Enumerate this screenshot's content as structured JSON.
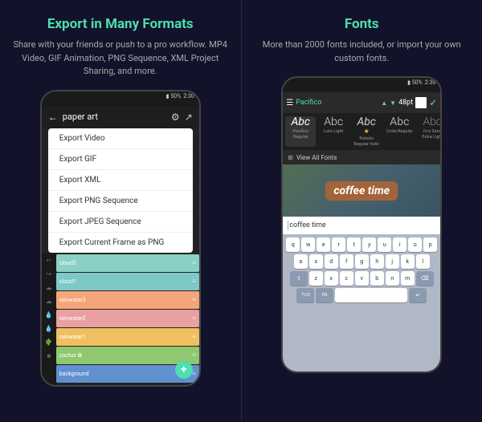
{
  "left": {
    "title": "Export in Many Formats",
    "description": "Share with your friends or push to a pro workflow. MP4 Video, GIF Animation, PNG Sequence, XML Project Sharing, and more.",
    "phone": {
      "status": "50%",
      "time": "2:30",
      "header_title": "paper art",
      "export_items": [
        "Export Video",
        "Export GIF",
        "Export XML",
        "Export PNG Sequence",
        "Export JPEG Sequence",
        "Export Current Frame as PNG"
      ],
      "layers": [
        {
          "name": "cloud2",
          "color": "#89d0c5"
        },
        {
          "name": "cloud1",
          "color": "#7ec8c8"
        },
        {
          "name": "rainwater3",
          "color": "#f5a57a"
        },
        {
          "name": "rainwater2",
          "color": "#e8a0a0"
        },
        {
          "name": "rainwater1",
          "color": "#f0c060"
        },
        {
          "name": "cactus",
          "color": "#90c870"
        },
        {
          "name": "background",
          "color": "#6090d0"
        }
      ],
      "fab": "+"
    }
  },
  "right": {
    "title": "Fonts",
    "description": "More than 2000 fonts included, or import your own custom fonts.",
    "phone": {
      "status": "50%",
      "time": "2:30",
      "font_name": "Pacifico",
      "font_size": "48pt",
      "font_samples": [
        {
          "label": "Pacifico\nRegular",
          "abc": "Abc",
          "style": "pacifico",
          "active": true
        },
        {
          "label": "Lato Light",
          "abc": "Abc",
          "style": "lato"
        },
        {
          "label": "Roboto\nRegular Italic",
          "abc": "Abc",
          "style": "roboto-italic",
          "star": true
        },
        {
          "label": "Coda Regular",
          "abc": "Abc",
          "style": "coda"
        },
        {
          "label": "Firs Sans\nExtra Light",
          "abc": "Abc",
          "style": "firs"
        }
      ],
      "view_all_fonts": "View All Fonts",
      "canvas_text": "coffee time",
      "input_text": "coffee time",
      "keyboard": {
        "row1": [
          "q",
          "w",
          "e",
          "r",
          "t",
          "y",
          "u",
          "i",
          "o",
          "p"
        ],
        "row2": [
          "a",
          "s",
          "d",
          "f",
          "g",
          "h",
          "j",
          "k",
          "l"
        ],
        "row3": [
          "↑",
          "z",
          "x",
          "c",
          "v",
          "b",
          "n",
          "m",
          "⌫"
        ],
        "row4": [
          "?123",
          "EN",
          "space",
          "↵"
        ]
      }
    }
  }
}
